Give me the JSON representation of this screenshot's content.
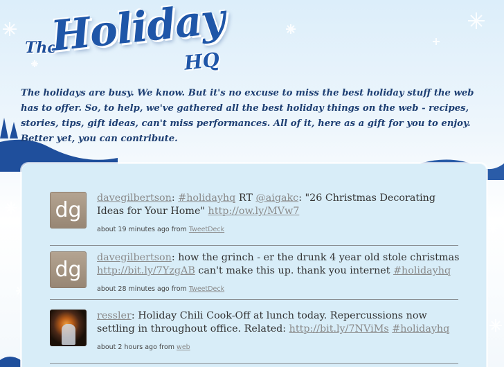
{
  "header": {
    "logo_the": "The",
    "logo_holiday": "Holiday",
    "logo_hq": "HQ",
    "intro": "The holidays are busy. We know. But it's no excuse to miss the best holiday stuff the web has to offer. So, to help, we've gathered all the best holiday things on the web - recipes, stories, tips, gift ideas, can't miss performances. All of it, here as a gift for you to enjoy. Better yet, you can contribute."
  },
  "tweets": [
    {
      "avatar": "dg",
      "user": "davegilbertson",
      "sep": ": ",
      "hashtag1": "#holidayhq",
      "text1": " RT ",
      "mention": "@aigakc",
      "text2": ": \"26 Christmas Decorating Ideas for Your Home\" ",
      "link": "http://ow.ly/MVw7",
      "time": "about 19 minutes ago from ",
      "source": "TweetDeck"
    },
    {
      "avatar": "dg",
      "user": "davegilbertson",
      "text1": ": how the grinch - er the drunk 4 year old stole christmas ",
      "link": "http://bit.ly/7YzgAB",
      "text2": " can't make this up. thank you internet ",
      "hashtag": "#holidayhq",
      "time": "about 28 minutes ago from ",
      "source": "TweetDeck"
    },
    {
      "avatar": "user-photo",
      "user": "ressler",
      "text1": ": Holiday Chili Cook-Off at lunch today. Repercussions now settling in throughout office. Related: ",
      "link": "http://bit.ly/7NViMs",
      "text2": " ",
      "hashtag": "#holidayhq",
      "time": "about 2 hours ago from ",
      "source": "web"
    }
  ],
  "colors": {
    "logo_blue": "#1f56a8",
    "intro_text": "#1e3f73",
    "panel_bg": "#d8edf8",
    "link_gray": "#8a8a8a"
  }
}
